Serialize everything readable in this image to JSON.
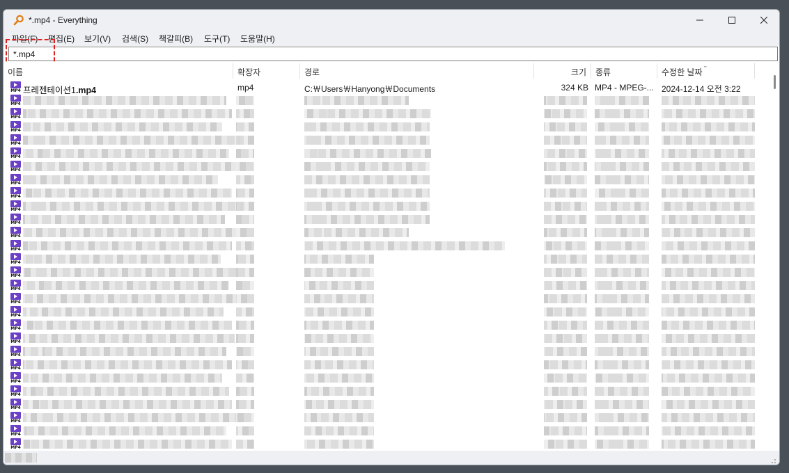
{
  "window": {
    "title": "*.mp4 - Everything"
  },
  "menu": [
    {
      "label": "파일(F)"
    },
    {
      "label": "편집(E)"
    },
    {
      "label": "보기(V)"
    },
    {
      "label": "검색(S)"
    },
    {
      "label": "책갈피(B)"
    },
    {
      "label": "도구(T)"
    },
    {
      "label": "도움말(H)"
    }
  ],
  "search": {
    "value": "*.mp4"
  },
  "columns": {
    "name": "이름",
    "ext": "확장자",
    "path": "경로",
    "size": "크기",
    "type": "종류",
    "modified": "수정한 날짜"
  },
  "rows": [
    {
      "name_prefix": "프레젠테이션1",
      "name_match": ".mp4",
      "ext": "mp4",
      "path": "C:￦Users￦Hanyong￦Documents",
      "size": "324 KB",
      "type": "MP4 - MPEG-...",
      "modified": "2024-12-14 오전 3:22"
    }
  ],
  "icon": {
    "file_type_label": "MP4",
    "app_icon": "magnifier-icon"
  },
  "colors": {
    "mp4_icon": "#6b3fc6",
    "highlight": "#e0201e"
  }
}
